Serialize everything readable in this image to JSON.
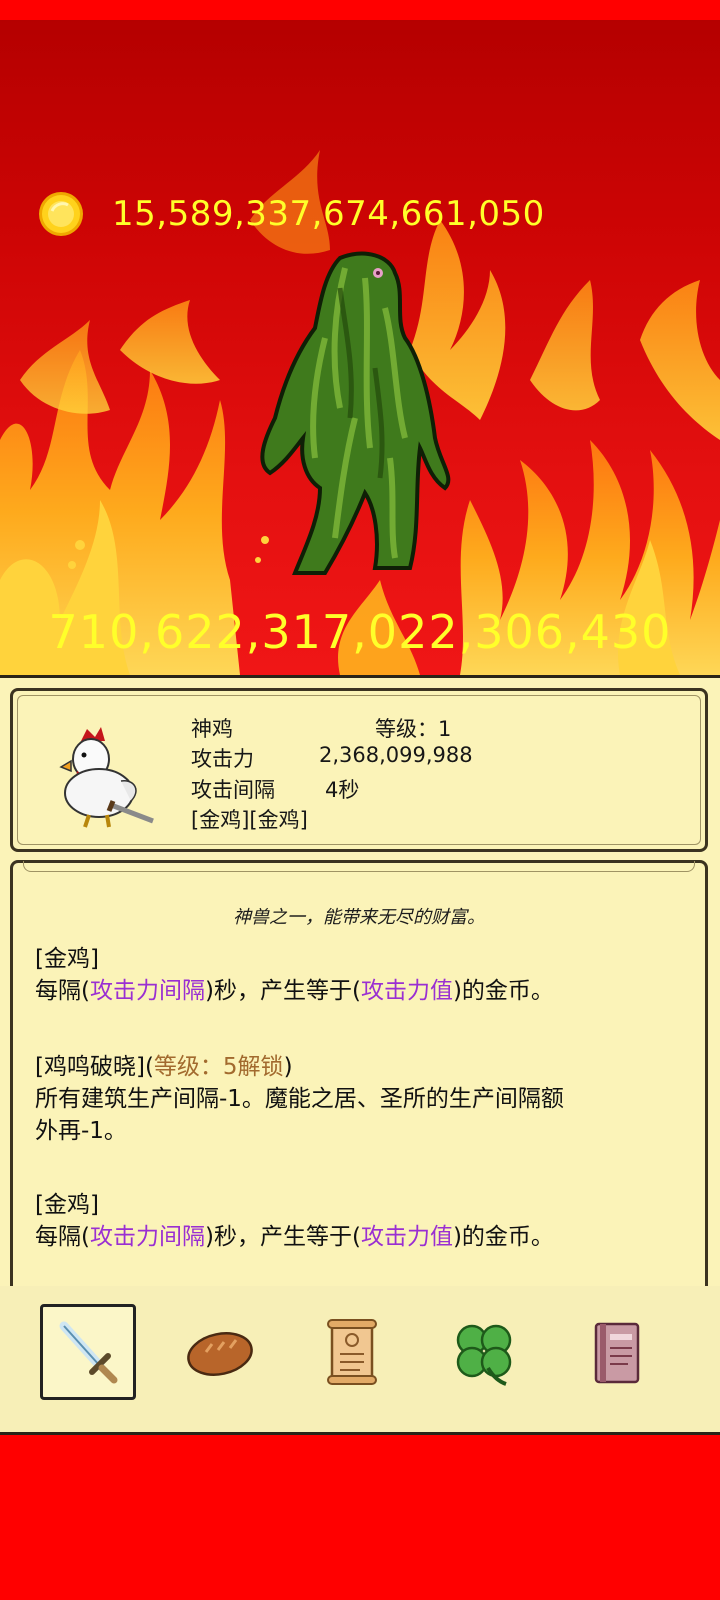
{
  "currency": {
    "icon": "gold-coin-icon",
    "amount": "15,589,337,674,661,050"
  },
  "boss": {
    "icon": "swamp-monster-sprite",
    "hp": "710,622,317,022,306,430"
  },
  "hero": {
    "portrait_icon": "chicken-warrior-icon",
    "name": "神鸡",
    "level_label": "等级：1",
    "attack_label": "攻击力",
    "attack_value": "2,368,099,988",
    "interval_label": "攻击间隔",
    "interval_value": "4秒",
    "tags": "[金鸡][金鸡]"
  },
  "description": {
    "tagline": "神兽之一，能带来无尽的财富。",
    "skill1_title": "[金鸡]",
    "skill1_p1": "每隔(",
    "skill1_hl1": "攻击力间隔",
    "skill1_p2": ")秒，产生等于(",
    "skill1_hl2": "攻击力值",
    "skill1_p3": ")的金币。",
    "skill2_title": "[鸡鸣破晓](",
    "skill2_unlock": "等级：5解锁",
    "skill2_close": ")",
    "skill2_line1": "所有建筑生产间隔-1。魔能之居、圣所的生产间隔额",
    "skill2_line2": "外再-1。",
    "skill3_title": "[金鸡]",
    "skill3_p1": "每隔(",
    "skill3_hl1": "攻击力间隔",
    "skill3_p2": ")秒，产生等于(",
    "skill3_hl2": "攻击力值",
    "skill3_p3": ")的金币。"
  },
  "toolbar": {
    "items": [
      {
        "icon": "sword-icon",
        "selected": true
      },
      {
        "icon": "bread-icon",
        "selected": false
      },
      {
        "icon": "scroll-icon",
        "selected": false
      },
      {
        "icon": "clover-icon",
        "selected": false
      },
      {
        "icon": "book-icon",
        "selected": false
      }
    ]
  },
  "colors": {
    "background": "#ff0000",
    "number_yellow": "#ffff2a",
    "panel": "#fbf3b8",
    "highlight_purple": "#9a2fd2",
    "highlight_brown": "#a26a2e"
  }
}
